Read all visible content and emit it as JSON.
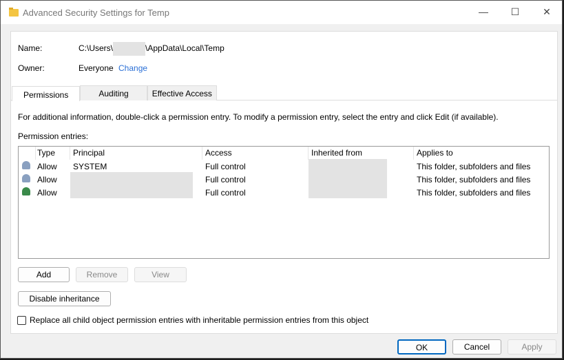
{
  "window": {
    "title": "Advanced Security Settings for Temp",
    "minimize": "—",
    "maximize": "☐",
    "close": "✕"
  },
  "name_label": "Name:",
  "name_value_prefix": "C:\\Users\\",
  "name_value_suffix": "\\AppData\\Local\\Temp",
  "owner_label": "Owner:",
  "owner_value": "Everyone",
  "change_link": "Change",
  "tabs": [
    "Permissions",
    "Auditing",
    "Effective Access"
  ],
  "info": "For additional information, double-click a permission entry. To modify a permission entry, select the entry and click Edit (if available).",
  "entries_label": "Permission entries:",
  "columns": [
    "Type",
    "Principal",
    "Access",
    "Inherited from",
    "Applies to"
  ],
  "rows": [
    {
      "type": "Allow",
      "principal": "SYSTEM",
      "access": "Full control",
      "applies": "This folder, subfolders and files"
    },
    {
      "type": "Allow",
      "principal": "",
      "access": "Full control",
      "applies": "This folder, subfolders and files"
    },
    {
      "type": "Allow",
      "principal": "",
      "access": "Full control",
      "applies": "This folder, subfolders and files"
    }
  ],
  "buttons": {
    "add": "Add",
    "remove": "Remove",
    "view": "View",
    "disable": "Disable inheritance",
    "ok": "OK",
    "cancel": "Cancel",
    "apply": "Apply"
  },
  "replace_checkbox": "Replace all child object permission entries with inheritable permission entries from this object"
}
